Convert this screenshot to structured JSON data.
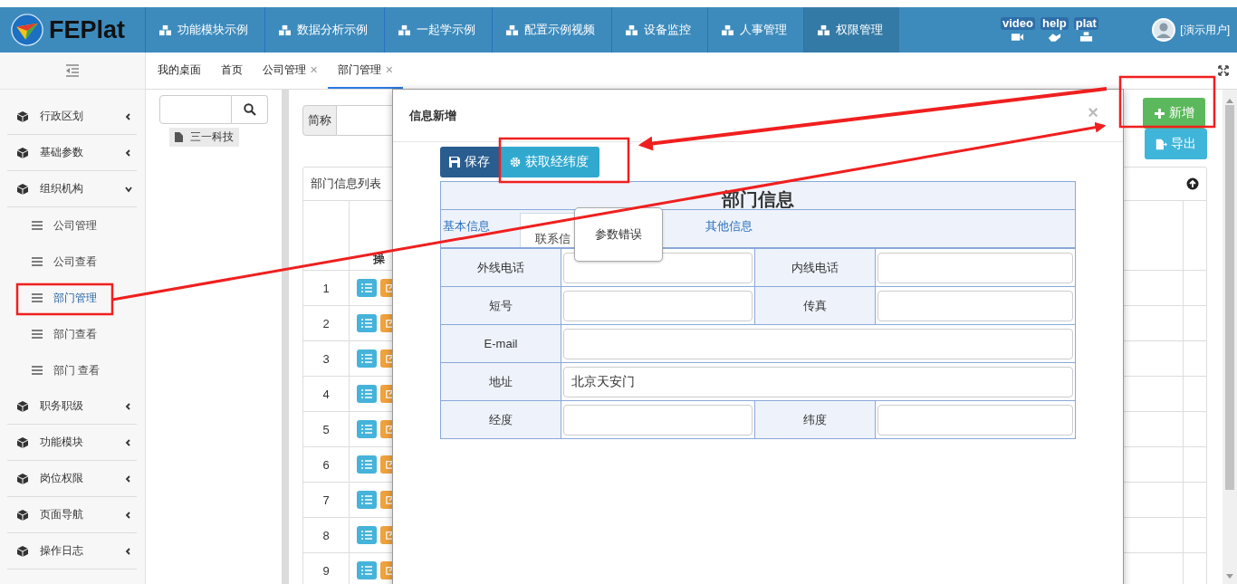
{
  "header": {
    "logo": "FEPlat",
    "nav": [
      {
        "label": "功能模块示例",
        "selected": false
      },
      {
        "label": "数据分析示例",
        "selected": false
      },
      {
        "label": "一起学示例",
        "selected": false
      },
      {
        "label": "配置示例视频",
        "selected": false
      },
      {
        "label": "设备监控",
        "selected": false
      },
      {
        "label": "人事管理",
        "selected": false
      },
      {
        "label": "权限管理",
        "selected": true
      }
    ],
    "links": [
      {
        "label": "video",
        "kind": "video"
      },
      {
        "label": "help",
        "kind": "help"
      },
      {
        "label": "plat",
        "kind": "plat"
      }
    ],
    "user": "[演示用户]"
  },
  "sidebar": {
    "items": [
      {
        "label": "行政区划",
        "expanded": false
      },
      {
        "label": "基础参数",
        "expanded": false
      },
      {
        "label": "组织机构",
        "expanded": true,
        "children": [
          {
            "label": "公司管理",
            "selected": false
          },
          {
            "label": "公司查看",
            "selected": false
          },
          {
            "label": "部门管理",
            "selected": true
          },
          {
            "label": "部门查看",
            "selected": false
          },
          {
            "label": "部门 查看",
            "selected": false
          }
        ]
      },
      {
        "label": "职务职级",
        "expanded": false
      },
      {
        "label": "功能模块",
        "expanded": false
      },
      {
        "label": "岗位权限",
        "expanded": false
      },
      {
        "label": "页面导航",
        "expanded": false
      },
      {
        "label": "操作日志",
        "expanded": false
      }
    ]
  },
  "tabs": [
    {
      "label": "我的桌面",
      "selected": false
    },
    {
      "label": "首页",
      "selected": false
    },
    {
      "label": "公司管理",
      "close": "✕",
      "selected": false
    },
    {
      "label": "部门管理",
      "close": "✕",
      "selected": true
    }
  ],
  "tree": {
    "nodes": [
      "三一科技"
    ]
  },
  "search": {
    "label": "简称"
  },
  "actions": [
    {
      "label": "新增",
      "kind": "add"
    },
    {
      "label": "导出",
      "kind": "export"
    }
  ],
  "list": {
    "title": "部门信息列表",
    "header": "操",
    "rows": [
      "1",
      "2",
      "3",
      "4",
      "5",
      "6",
      "7",
      "8",
      "9"
    ]
  },
  "dialog": {
    "title": "信息新增",
    "close": "×",
    "buttons": [
      {
        "label": "保存",
        "kind": "save"
      },
      {
        "label": "获取经纬度",
        "kind": "locate"
      }
    ],
    "section": "部门信息",
    "tabs": [
      {
        "label": "基本信息",
        "selected": false
      },
      {
        "label": "联系信",
        "selected": true
      },
      {
        "label": "其他信息",
        "selected": false
      }
    ],
    "rows": [
      [
        {
          "label": "外线电话"
        },
        {
          "label": "内线电话"
        }
      ],
      [
        {
          "label": "短号"
        },
        {
          "label": "传真"
        }
      ],
      [
        {
          "label": "E-mail"
        }
      ],
      [
        {
          "label": "地址",
          "value": "北京天安门"
        }
      ],
      [
        {
          "label": "经度"
        },
        {
          "label": "纬度"
        }
      ]
    ],
    "tooltip": "参数错误"
  }
}
